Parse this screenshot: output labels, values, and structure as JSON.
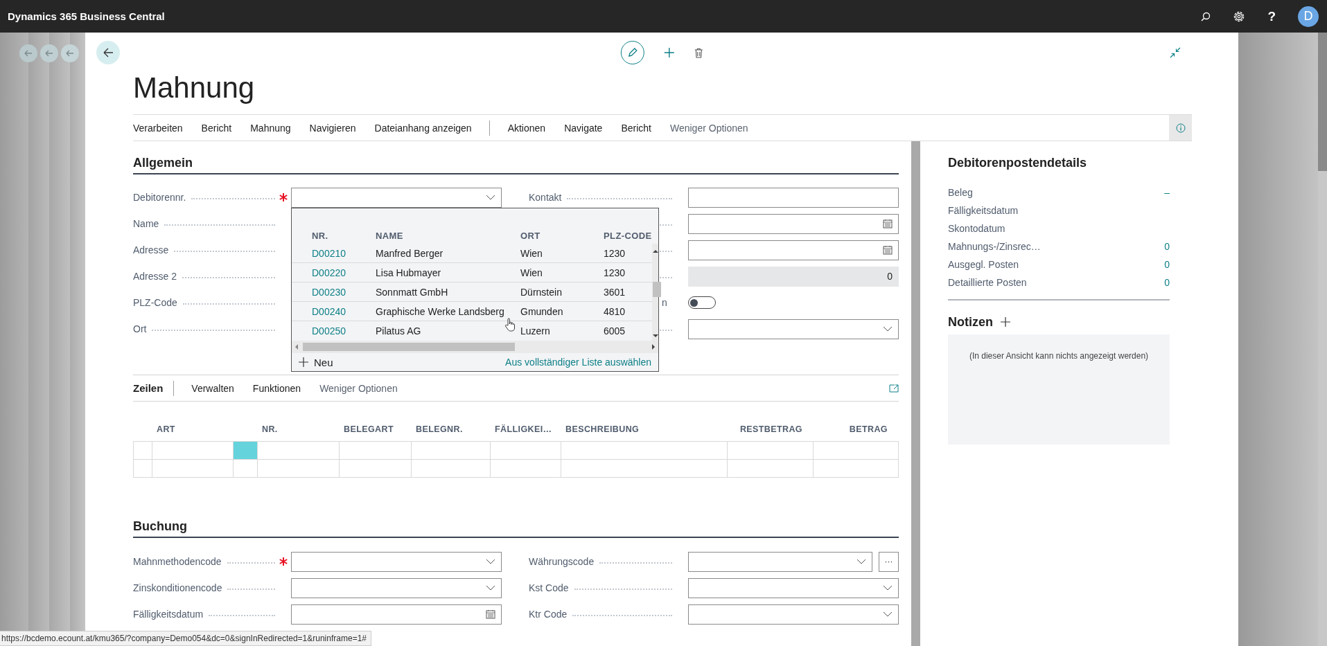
{
  "app_bar": {
    "title": "Dynamics 365 Business Central",
    "help": "?",
    "avatar": "D"
  },
  "page": {
    "title": "Mahnung"
  },
  "actions": [
    {
      "kind": "action",
      "label": "Verarbeiten"
    },
    {
      "kind": "action",
      "label": "Bericht"
    },
    {
      "kind": "action",
      "label": "Mahnung"
    },
    {
      "kind": "action",
      "label": "Navigieren"
    },
    {
      "kind": "action",
      "label": "Dateianhang anzeigen"
    },
    {
      "kind": "separator"
    },
    {
      "kind": "action",
      "label": "Aktionen"
    },
    {
      "kind": "action",
      "label": "Navigate"
    },
    {
      "kind": "action",
      "label": "Bericht"
    },
    {
      "kind": "toggle",
      "label": "Weniger Optionen"
    }
  ],
  "general": {
    "heading": "Allgemein",
    "rows": [
      {
        "left": {
          "label": "Debitorennr.",
          "required": true,
          "kind": "dropdown"
        },
        "right": {
          "label": "Kontakt",
          "kind": "text"
        }
      },
      {
        "left": {
          "label": "Name",
          "kind": "covered"
        },
        "right": {
          "kind": "date"
        }
      },
      {
        "left": {
          "label": "Adresse",
          "kind": "covered"
        },
        "right": {
          "kind": "date"
        }
      },
      {
        "left": {
          "label": "Adresse 2",
          "kind": "covered"
        },
        "right": {
          "kind": "readonly",
          "value": "0"
        }
      },
      {
        "left": {
          "label": "PLZ-Code",
          "kind": "covered"
        },
        "right": {
          "label": "n",
          "clipped": true,
          "kind": "toggle",
          "on": false
        }
      },
      {
        "left": {
          "label": "Ort",
          "kind": "covered"
        },
        "right": {
          "kind": "dropdown"
        }
      }
    ]
  },
  "lookup": {
    "columns": [
      "NR.",
      "NAME",
      "ORT",
      "PLZ-CODE"
    ],
    "rows": [
      {
        "nr": "D00210",
        "name": "Manfred Berger",
        "city": "Wien",
        "zip": "1230"
      },
      {
        "nr": "D00220",
        "name": "Lisa Hubmayer",
        "city": "Wien",
        "zip": "1230"
      },
      {
        "nr": "D00230",
        "name": "Sonnmatt GmbH",
        "city": "Dürnstein",
        "zip": "3601"
      },
      {
        "nr": "D00240",
        "name": "Graphische Werke Landsberg",
        "city": "Gmunden",
        "zip": "4810"
      },
      {
        "nr": "D00250",
        "name": "Pilatus AG",
        "city": "Luzern",
        "zip": "6005"
      }
    ],
    "new_label": "Neu",
    "full_list_link": "Aus vollständiger Liste auswählen"
  },
  "lines": {
    "heading": "Zeilen",
    "actions": [
      {
        "kind": "action",
        "label": "Verwalten"
      },
      {
        "kind": "action",
        "label": "Funktionen"
      },
      {
        "kind": "toggle",
        "label": "Weniger Optionen"
      }
    ],
    "columns": [
      "ART",
      "NR.",
      "BELEGART",
      "BELEGNR.",
      "FÄLLIGKEI…",
      "BESCHREIBUNG",
      "RESTBETRAG",
      "BETRAG"
    ],
    "rows": [
      {
        "cells": [
          {
            "selected": false
          },
          {
            "selected": false
          },
          {
            "selected": true
          },
          {
            "selected": false
          },
          {
            "selected": false
          },
          {
            "selected": false
          },
          {
            "selected": false
          },
          {
            "selected": false
          },
          {
            "selected": false
          },
          {
            "selected": false
          }
        ]
      },
      {
        "cells": [
          {
            "selected": false
          },
          {
            "selected": false
          },
          {
            "selected": false
          },
          {
            "selected": false
          },
          {
            "selected": false
          },
          {
            "selected": false
          },
          {
            "selected": false
          },
          {
            "selected": false
          },
          {
            "selected": false
          },
          {
            "selected": false
          }
        ]
      }
    ]
  },
  "posting": {
    "heading": "Buchung",
    "rows": [
      {
        "left": {
          "label": "Mahnmethodencode",
          "required": true,
          "kind": "dropdown"
        },
        "right": {
          "label": "Währungscode",
          "kind": "dropdown_more",
          "more_label": "···"
        }
      },
      {
        "left": {
          "label": "Zinskonditionencode",
          "kind": "dropdown"
        },
        "right": {
          "label": "Kst Code",
          "kind": "dropdown"
        }
      },
      {
        "left": {
          "label": "Fälligkeitsdatum",
          "kind": "date"
        },
        "right": {
          "label": "Ktr Code",
          "kind": "dropdown"
        }
      }
    ]
  },
  "factbox": {
    "title": "Debitorenpostendetails",
    "rows": [
      {
        "label": "Beleg",
        "value": "–"
      },
      {
        "label": "Fälligkeitsdatum"
      },
      {
        "label": "Skontodatum"
      },
      {
        "label": "Mahnungs-/Zinsrec…",
        "value": "0"
      },
      {
        "label": "Ausgegl. Posten",
        "value": "0"
      },
      {
        "label": "Detaillierte Posten",
        "value": "0"
      }
    ],
    "notes": {
      "title": "Notizen",
      "empty_text": "(In dieser Ansicht kann nichts angezeigt werden)"
    }
  },
  "status_url": "https://bcdemo.ecount.at/kmu365/?company=Demo054&dc=0&signInRedirected=1&runinframe=1#"
}
